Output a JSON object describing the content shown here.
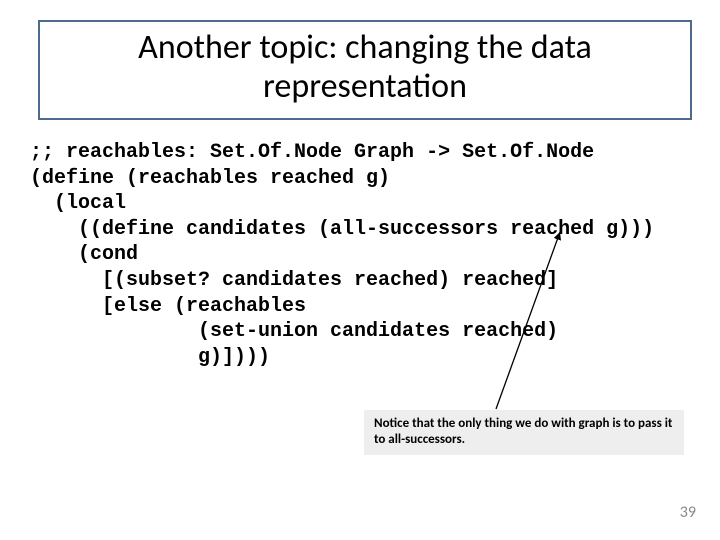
{
  "title": "Another topic: changing the data representation",
  "code": ";; reachables: Set.Of.Node Graph -> Set.Of.Node\n(define (reachables reached g)\n  (local\n    ((define candidates (all-successors reached g)))\n    (cond\n      [(subset? candidates reached) reached]\n      [else (reachables\n              (set-union candidates reached)\n              g)])))",
  "callout": "Notice that the only thing we do with graph is to pass it to all-successors.",
  "page_number": "39"
}
